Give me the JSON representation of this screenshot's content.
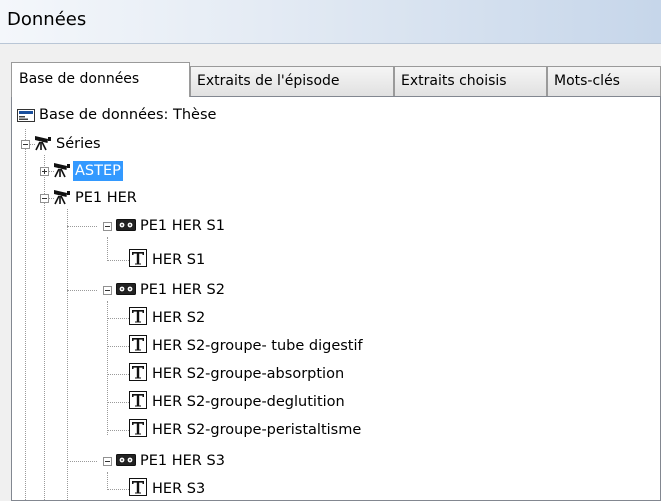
{
  "window": {
    "title": "Données"
  },
  "tabs": [
    {
      "label": "Base de données",
      "active": true
    },
    {
      "label": "Extraits de l'épisode",
      "active": false
    },
    {
      "label": "Extraits choisis",
      "active": false
    },
    {
      "label": "Mots-clés",
      "active": false
    }
  ],
  "tree": {
    "root": {
      "label": "Base de données: Thèse",
      "icon": "database-icon"
    },
    "series_folder": {
      "label": "Séries",
      "icon": "camera-icon",
      "expanded": true
    },
    "astep": {
      "label": "ASTEP",
      "icon": "camera-icon",
      "expanded": false,
      "selected": true
    },
    "pe1her": {
      "label": "PE1 HER",
      "icon": "camera-icon",
      "expanded": true
    },
    "s1": {
      "label": "PE1 HER S1",
      "icon": "cassette-icon",
      "expanded": true
    },
    "s1_t1": {
      "label": "HER S1",
      "icon": "transcript-icon"
    },
    "s2": {
      "label": "PE1 HER S2",
      "icon": "cassette-icon",
      "expanded": true
    },
    "s2_t1": {
      "label": "HER S2",
      "icon": "transcript-icon"
    },
    "s2_t2": {
      "label": "HER S2-groupe- tube digestif",
      "icon": "transcript-icon"
    },
    "s2_t3": {
      "label": "HER S2-groupe-absorption",
      "icon": "transcript-icon"
    },
    "s2_t4": {
      "label": "HER S2-groupe-deglutition",
      "icon": "transcript-icon"
    },
    "s2_t5": {
      "label": "HER S2-groupe-peristaltisme",
      "icon": "transcript-icon"
    },
    "s3": {
      "label": "PE1 HER S3",
      "icon": "cassette-icon",
      "expanded": true
    },
    "s3_t1": {
      "label": "HER S3",
      "icon": "transcript-icon"
    }
  }
}
